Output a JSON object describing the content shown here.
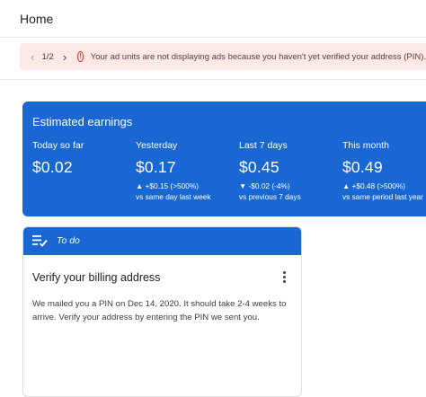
{
  "header": {
    "title": "Home"
  },
  "alert": {
    "pager": "1/2",
    "prev_icon": "chevron-left-icon",
    "next_icon": "chevron-right-icon",
    "status_icon": "error-icon",
    "status_color": "#d93025",
    "message": "Your ad units are not displaying ads because you haven't yet verified your address (PIN)."
  },
  "earnings": {
    "title": "Estimated earnings",
    "accent": "#1967d2",
    "metrics": [
      {
        "label": "Today so far",
        "value": "$0.02",
        "change": "",
        "compare": ""
      },
      {
        "label": "Yesterday",
        "value": "$0.17",
        "change": "▲ +$0.15 (>500%)",
        "compare": "vs same day last week"
      },
      {
        "label": "Last 7 days",
        "value": "$0.45",
        "change": "▼ -$0.02 (-4%)",
        "compare": "vs previous 7 days"
      },
      {
        "label": "This month",
        "value": "$0.49",
        "change": "▲ +$0.48 (>500%)",
        "compare": "vs same period last year"
      }
    ]
  },
  "todo": {
    "bar_label": "To do",
    "bar_icon": "checklist-icon",
    "card": {
      "title": "Verify your billing address",
      "more_icon": "more-vert-icon",
      "description": "We mailed you a PIN on Dec 14, 2020. It should take 2-4 weeks to arrive. Verify your address by entering the PIN we sent you."
    }
  }
}
